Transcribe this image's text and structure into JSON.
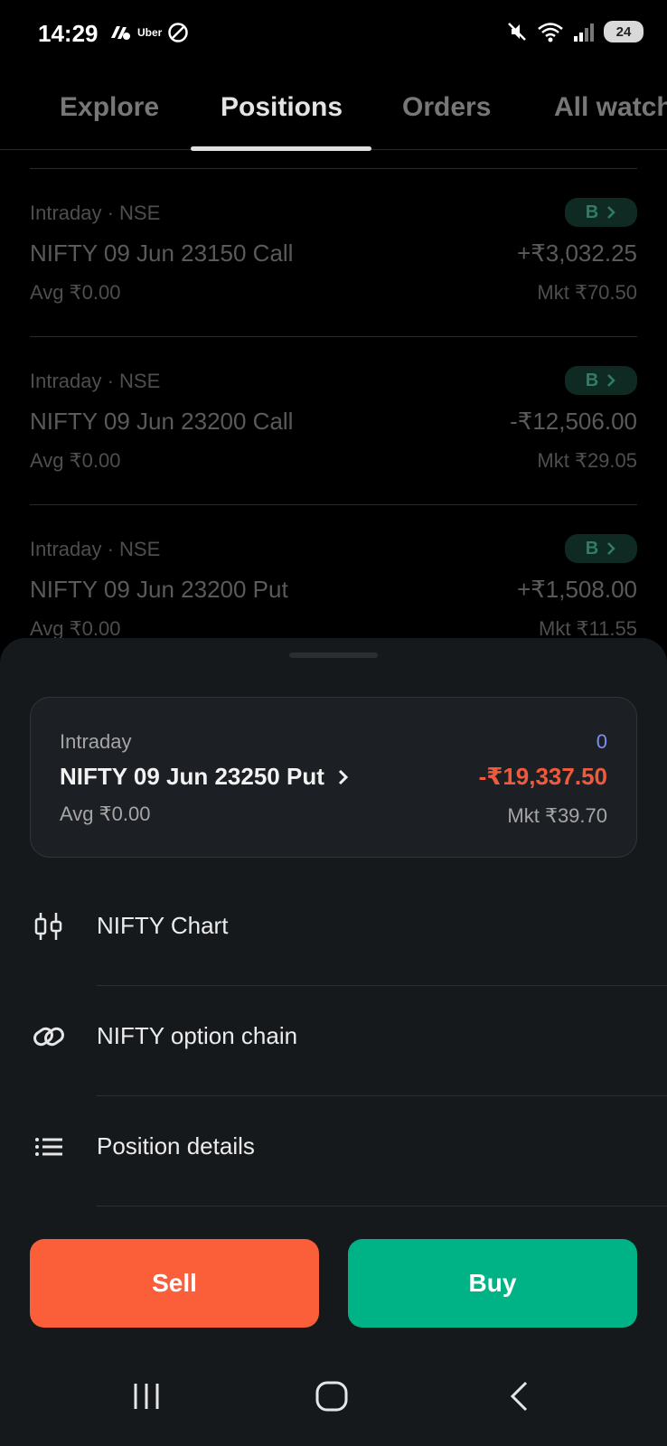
{
  "status_bar": {
    "time": "14:29",
    "uber_label": "Uber",
    "battery": "24",
    "icons": [
      "uber-icon",
      "do-not-disturb-icon",
      "mute-icon",
      "wifi-icon",
      "signal-icon",
      "battery-icon"
    ]
  },
  "tabs": [
    {
      "label": "Explore",
      "active": false
    },
    {
      "label": "Positions",
      "active": true
    },
    {
      "label": "Orders",
      "active": false
    },
    {
      "label": "All watch",
      "active": false
    }
  ],
  "positions": [
    {
      "meta": "Intraday · NSE",
      "name": "NIFTY 09 Jun 23150 Call",
      "avg": "Avg ₹0.00",
      "pnl": "+₹3,032.25",
      "mkt": "Mkt ₹70.50",
      "badge": "B"
    },
    {
      "meta": "Intraday · NSE",
      "name": "NIFTY 09 Jun 23200 Call",
      "avg": "Avg ₹0.00",
      "pnl": "-₹12,506.00",
      "mkt": "Mkt ₹29.05",
      "badge": "B"
    },
    {
      "meta": "Intraday · NSE",
      "name": "NIFTY 09 Jun 23200 Put",
      "avg": "Avg ₹0.00",
      "pnl": "+₹1,508.00",
      "mkt": "Mkt ₹11.55",
      "badge": "B"
    }
  ],
  "sheet": {
    "summary": {
      "type": "Intraday",
      "name": "NIFTY 09 Jun 23250 Put",
      "avg": "Avg ₹0.00",
      "qty": "0",
      "pnl": "-₹19,337.50",
      "mkt": "Mkt ₹39.70"
    },
    "menu": [
      {
        "label": "NIFTY Chart",
        "icon": "candlestick-icon"
      },
      {
        "label": "NIFTY option chain",
        "icon": "link-icon"
      },
      {
        "label": "Position details",
        "icon": "list-icon"
      }
    ],
    "sell_label": "Sell",
    "buy_label": "Buy"
  },
  "colors": {
    "sell": "#fa5f3a",
    "buy": "#00b386",
    "loss": "#f05a3c",
    "qty": "#7c8ef2"
  }
}
